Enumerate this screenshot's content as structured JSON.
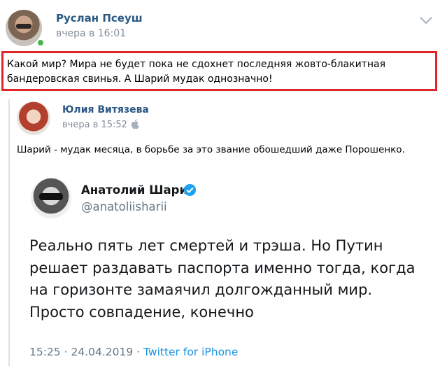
{
  "post": {
    "author": "Руслан Псеуш",
    "time": "вчера в 16:01",
    "text": "Какой мир? Мира не будет пока не сдохнет последняя жовто-блакитная бандеровская свинья. А Шарий мудак однозначно!"
  },
  "repost": {
    "author": "Юлия Витязева",
    "time": "вчера в 15:52",
    "text": "Шарий - мудак месяца, в борьбе за это звание обошедший даже Порошенко."
  },
  "tweet": {
    "name": "Анатолий Шарий",
    "handle": "@anatoliisharii",
    "text": "Реально пять лет смертей и трэша. Но Путин решает раздавать паспорта именно тогда, когда на горизонте замаячил долгожданный мир. Просто совпадение, конечно",
    "datetime": "15:25 · 24.04.2019 · ",
    "source": "Twitter for iPhone"
  },
  "colors": {
    "link": "#2a5885",
    "highlight_border": "#e0262a",
    "online": "#4bb34b",
    "verified": "#1da1f2"
  },
  "icons": {
    "options": "chevron-down-icon",
    "platform": "apple-icon",
    "verified": "verified-badge-icon"
  }
}
